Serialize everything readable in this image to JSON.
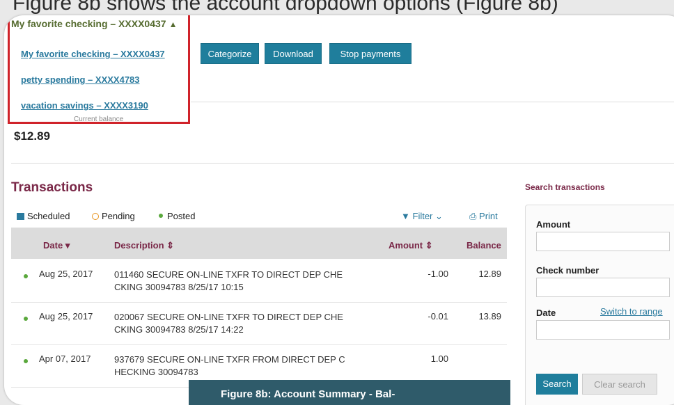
{
  "background_caption": "Figure 8b shows the account dropdown options (Figure 8b)",
  "account": {
    "title": "My favorite checking – XXXX0437",
    "caret_icon": "chevron-up-icon",
    "options": [
      "My favorite checking – XXXX0437",
      "petty spending – XXXX4783",
      "vacation savings – XXXX3190"
    ]
  },
  "actions": {
    "categorize": "Categorize",
    "download": "Download",
    "stop_payments": "Stop payments"
  },
  "balance": {
    "label": "Current balance",
    "value": "$12.89"
  },
  "transactions": {
    "title": "Transactions",
    "legend": {
      "scheduled": "Scheduled",
      "pending": "Pending",
      "posted": "Posted"
    },
    "filter_label": "Filter",
    "print_label": "Print",
    "headers": {
      "date": "Date",
      "description": "Description",
      "amount": "Amount",
      "balance": "Balance"
    },
    "rows": [
      {
        "date": "Aug 25, 2017",
        "description": "011460 SECURE ON-LINE TXFR TO DIRECT DEP CHE CKING 30094783 8/25/17 10:15",
        "amount": "-1.00",
        "balance": "12.89"
      },
      {
        "date": "Aug 25, 2017",
        "description": "020067 SECURE ON-LINE TXFR TO DIRECT DEP CHE CKING 30094783 8/25/17 14:22",
        "amount": "-0.01",
        "balance": "13.89"
      },
      {
        "date": "Apr 07, 2017",
        "description": "937679 SECURE ON-LINE TXFR FROM DIRECT DEP C HECKING 30094783",
        "amount": "1.00",
        "balance": ""
      }
    ]
  },
  "search": {
    "title": "Search transactions",
    "amount_label": "Amount",
    "check_label": "Check number",
    "date_label": "Date",
    "switch_range": "Switch to range",
    "search_button": "Search",
    "clear_button": "Clear search"
  },
  "caption": "Figure 8b: Account Summary - Bal-",
  "colors": {
    "accent": "#1f7e9c",
    "title": "#7a2848",
    "highlight": "#d0232a",
    "caption_bg": "#2f5b6a"
  }
}
